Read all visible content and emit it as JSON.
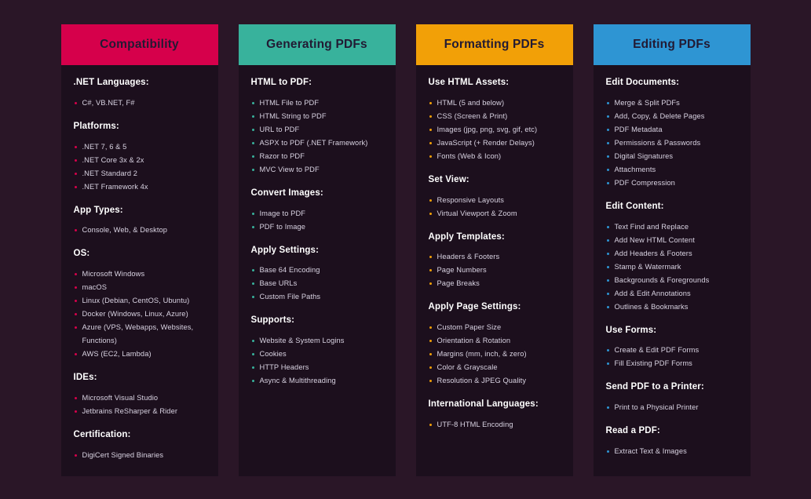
{
  "page": {
    "background_color": "#2a1627",
    "card_background_color": "#1c0f1d",
    "header_text_color": "#221a33",
    "section_title_color": "#ffffff",
    "item_text_color": "#d9d3e2"
  },
  "columns": [
    {
      "title": "Compatibility",
      "header_color": "#d6004b",
      "bullet_color": "#d6004b",
      "sections": [
        {
          "title": ".NET Languages:",
          "items": [
            "C#, VB.NET, F#"
          ]
        },
        {
          "title": "Platforms:",
          "items": [
            ".NET 7, 6 & 5",
            ".NET Core 3x & 2x",
            ".NET Standard 2",
            ".NET Framework 4x"
          ]
        },
        {
          "title": "App Types:",
          "items": [
            "Console, Web, & Desktop"
          ]
        },
        {
          "title": "OS:",
          "items": [
            "Microsoft Windows",
            "macOS",
            "Linux (Debian, CentOS, Ubuntu)",
            "Docker (Windows, Linux, Azure)",
            "Azure (VPS, Webapps, Websites, Functions)",
            "AWS (EC2, Lambda)"
          ]
        },
        {
          "title": "IDEs:",
          "items": [
            "Microsoft Visual Studio",
            "Jetbrains ReSharper & Rider"
          ]
        },
        {
          "title": "Certification:",
          "items": [
            "DigiCert Signed Binaries"
          ]
        }
      ]
    },
    {
      "title": "Generating PDFs",
      "header_color": "#38b29c",
      "bullet_color": "#38b29c",
      "sections": [
        {
          "title": "HTML to PDF:",
          "items": [
            "HTML File to PDF",
            "HTML String to PDF",
            "URL to PDF",
            "ASPX to PDF (.NET Framework)",
            "Razor to PDF",
            "MVC View to PDF"
          ]
        },
        {
          "title": "Convert Images:",
          "items": [
            "Image to PDF",
            "PDF to Image"
          ]
        },
        {
          "title": "Apply Settings:",
          "items": [
            "Base 64 Encoding",
            "Base URLs",
            "Custom File Paths"
          ]
        },
        {
          "title": "Supports:",
          "items": [
            "Website & System Logins",
            "Cookies",
            "HTTP Headers",
            "Async & Multithreading"
          ]
        }
      ]
    },
    {
      "title": "Formatting PDFs",
      "header_color": "#f2a007",
      "bullet_color": "#f2a007",
      "sections": [
        {
          "title": "Use HTML Assets:",
          "items": [
            "HTML (5 and below)",
            "CSS (Screen & Print)",
            "Images (jpg, png, svg, gif, etc)",
            "JavaScript (+ Render Delays)",
            "Fonts (Web & Icon)"
          ]
        },
        {
          "title": "Set View:",
          "items": [
            "Responsive Layouts",
            "Virtual Viewport & Zoom"
          ]
        },
        {
          "title": "Apply Templates:",
          "items": [
            "Headers & Footers",
            "Page Numbers",
            "Page Breaks"
          ]
        },
        {
          "title": "Apply Page Settings:",
          "items": [
            "Custom Paper Size",
            "Orientation & Rotation",
            "Margins (mm, inch, & zero)",
            "Color & Grayscale",
            "Resolution & JPEG Quality"
          ]
        },
        {
          "title": "International Languages:",
          "items": [
            "UTF-8 HTML Encoding"
          ]
        }
      ]
    },
    {
      "title": "Editing PDFs",
      "header_color": "#2e95d3",
      "bullet_color": "#2e95d3",
      "sections": [
        {
          "title": "Edit Documents:",
          "items": [
            "Merge & Split PDFs",
            "Add, Copy, & Delete Pages",
            "PDF Metadata",
            "Permissions & Passwords",
            "Digital Signatures",
            "Attachments",
            "PDF Compression"
          ]
        },
        {
          "title": "Edit Content:",
          "items": [
            "Text Find and Replace",
            "Add New HTML Content",
            "Add Headers & Footers",
            "Stamp & Watermark",
            "Backgrounds & Foregrounds",
            "Add & Edit Annotations",
            "Outlines & Bookmarks"
          ]
        },
        {
          "title": "Use Forms:",
          "items": [
            "Create & Edit PDF Forms",
            "Fill Existing PDF Forms"
          ]
        },
        {
          "title": "Send PDF to a Printer:",
          "items": [
            "Print to a Physical Printer"
          ]
        },
        {
          "title": "Read a PDF:",
          "items": [
            "Extract Text & Images"
          ]
        }
      ]
    }
  ]
}
